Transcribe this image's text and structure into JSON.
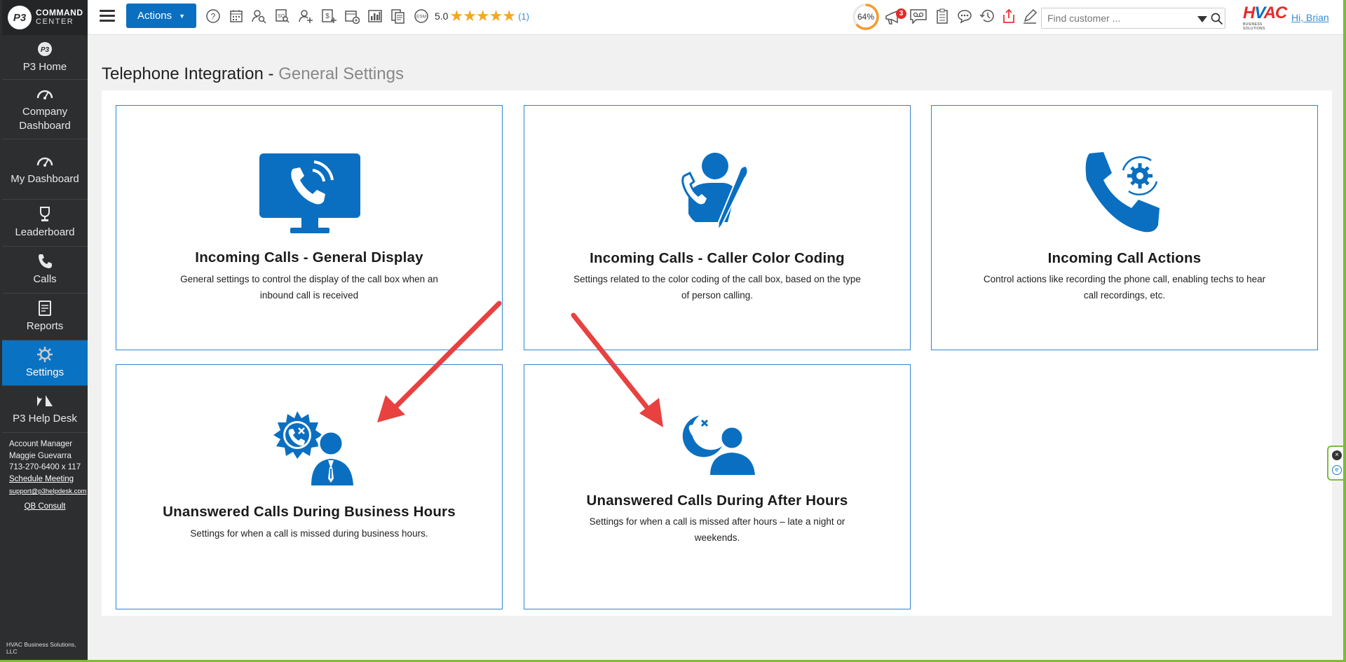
{
  "app": {
    "logo_mark": "P3",
    "logo_line1": "COMMAND",
    "logo_line2": "CENTER"
  },
  "sidebar": {
    "items": [
      {
        "label": "P3 Home",
        "icon": "p3-logo-icon"
      },
      {
        "label": "Company Dashboard",
        "icon": "gauge-icon"
      },
      {
        "label": "My Dashboard",
        "icon": "gauge-icon"
      },
      {
        "label": "Leaderboard",
        "icon": "trophy-icon"
      },
      {
        "label": "Calls",
        "icon": "phone-icon"
      },
      {
        "label": "Reports",
        "icon": "report-icon"
      },
      {
        "label": "Settings",
        "icon": "gear-icon",
        "active": true
      },
      {
        "label": "P3 Help Desk",
        "icon": "zendesk-icon"
      }
    ],
    "account": {
      "title": "Account Manager",
      "name": "Maggie Guevarra",
      "phone": "713-270-6400 x 117",
      "schedule": "Schedule Meeting",
      "email": "support@p3helpdesk.com",
      "qb": "QB Consult"
    },
    "footer": "HVAC Business Solutions, LLC"
  },
  "topbar": {
    "actions_label": "Actions",
    "rating_value": "5.0",
    "rating_stars": "★★★★★",
    "rating_count": "(1)",
    "progress": "64%",
    "progress_value": 64,
    "notification_count": "3",
    "search_placeholder": "Find customer ...",
    "brand": "HVAC",
    "brand_sub": "BUSINESS SOLUTIONS",
    "greeting": "Hi, Brian",
    "accent": "#0a6fc1"
  },
  "page": {
    "title_main": "Telephone Integration - ",
    "title_sub": "General Settings"
  },
  "cards": [
    {
      "title": "Incoming Calls - General Display",
      "desc1": "General settings to control the display of the call box when an",
      "desc2": "inbound call is received"
    },
    {
      "title": "Incoming Calls - Caller Color Coding",
      "desc1": "Settings related to the color coding of the call box, based on the type",
      "desc2": "of person calling."
    },
    {
      "title": "Incoming Call Actions",
      "desc1": "Control actions like recording the phone call, enabling techs to hear",
      "desc2": "call recordings, etc."
    },
    {
      "title": "Unanswered Calls During Business Hours",
      "desc1": "Settings for when a call is missed during business hours.",
      "desc2": ""
    },
    {
      "title": "Unanswered Calls During After Hours",
      "desc1": "Settings for when a call is missed after hours – late a night or",
      "desc2": "weekends."
    }
  ]
}
